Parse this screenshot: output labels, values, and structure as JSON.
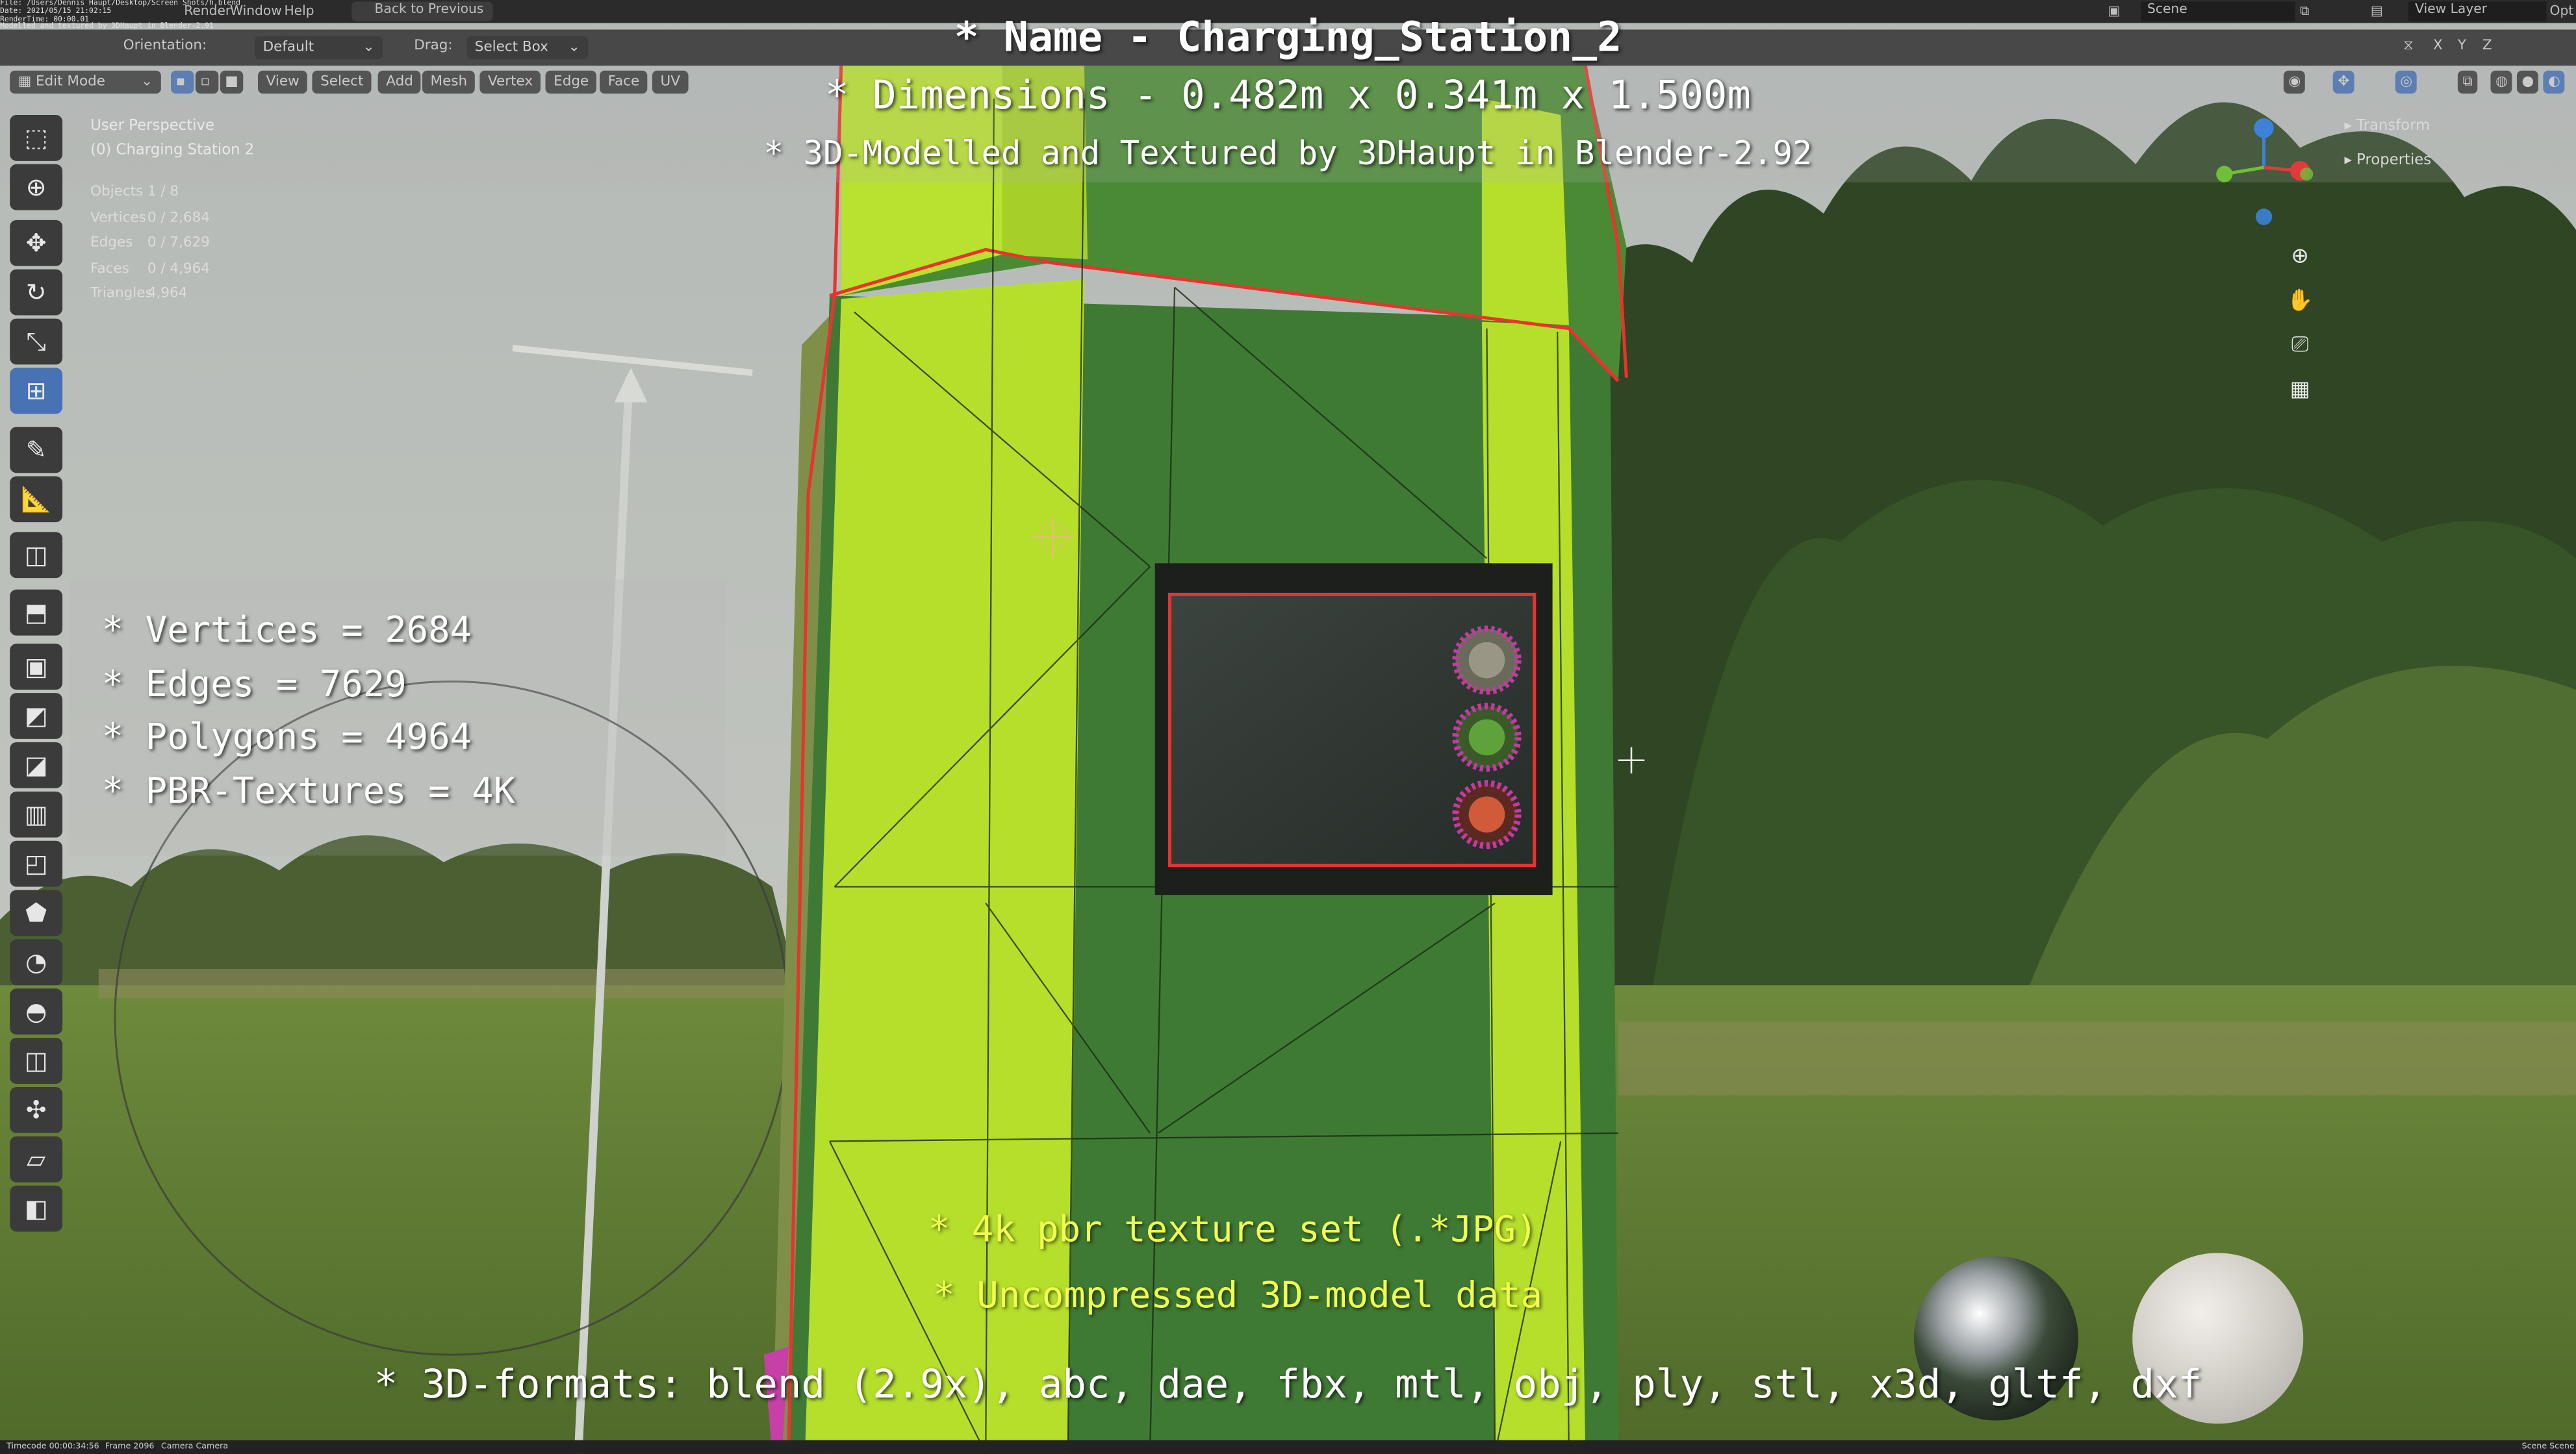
{
  "topbar": {
    "file_path": "File: /Users/Dennis Haupt/Desktop/Screen Shots/h.blend",
    "date": "Date: 2021/05/15 21:02:15",
    "render_time": "RenderTime: 00:00.01",
    "note": "Modelled and textured by 3DHaupt in Blender-2.91",
    "menu_render": "Render",
    "menu_window": "Window",
    "menu_help": "Help",
    "back_button": "Back to Previous",
    "scene_label": "Scene",
    "view_layer_label": "View Layer",
    "options_label": "Opt"
  },
  "header": {
    "orientation_label": "Orientation:",
    "orientation_value": "Default",
    "drag_label": "Drag:",
    "drag_value": "Select Box",
    "mode_value": "Edit Mode",
    "menus": [
      "View",
      "Select",
      "Add",
      "Mesh",
      "Vertex",
      "Edge",
      "Face",
      "UV"
    ],
    "axis_labels": [
      "X",
      "Y",
      "Z"
    ]
  },
  "viewport": {
    "perspective_label": "User Perspective",
    "object_label": "(0) Charging Station 2",
    "stats": [
      {
        "label": "Objects",
        "value": "1 / 8"
      },
      {
        "label": "Vertices",
        "value": "0 / 2,684"
      },
      {
        "label": "Edges",
        "value": "0 / 7,629"
      },
      {
        "label": "Faces",
        "value": "0 / 4,964"
      },
      {
        "label": "Triangles",
        "value": "4,964"
      }
    ],
    "right_panel": [
      "Transform",
      "Properties"
    ]
  },
  "title_overlay": {
    "name_line_prefix": "* Name - ",
    "name_line_value": "Charging_Station_2",
    "dimensions_prefix": "* Dimensions -  ",
    "dimensions_value": "0.482m x 0.341m x 1.500m",
    "credit_line": "* 3D-Modelled and Textured by 3DHaupt in Blender-2.92"
  },
  "spec_overlay": {
    "lines": [
      {
        "label": "* Vertices = ",
        "value": "2684"
      },
      {
        "label": "* Edges = ",
        "value": "7629"
      },
      {
        "label": "* Polygons = ",
        "value": "4964"
      },
      {
        "label": "* PBR-Textures = ",
        "value": "4K"
      }
    ]
  },
  "bottom_overlay": {
    "texture_line": "* 4k pbr texture set (.*JPG)",
    "model_line": "* Uncompressed 3D-model data",
    "formats_line": "* 3D-formats: blend (2.9x), abc, dae, fbx, mtl, obj, ply, stl, x3d, gltf, dxf"
  },
  "statusbar": {
    "timecode": "Timecode 00:00:34:56",
    "frame": "Frame 2096",
    "camera": "Camera Camera",
    "scene_right": "Scene Scene"
  },
  "colors": {
    "accent_blue": "#4772b3",
    "overlay_yellow": "#f0ff50",
    "station_green": "#3f7a35",
    "station_lime": "#b6df2c"
  }
}
